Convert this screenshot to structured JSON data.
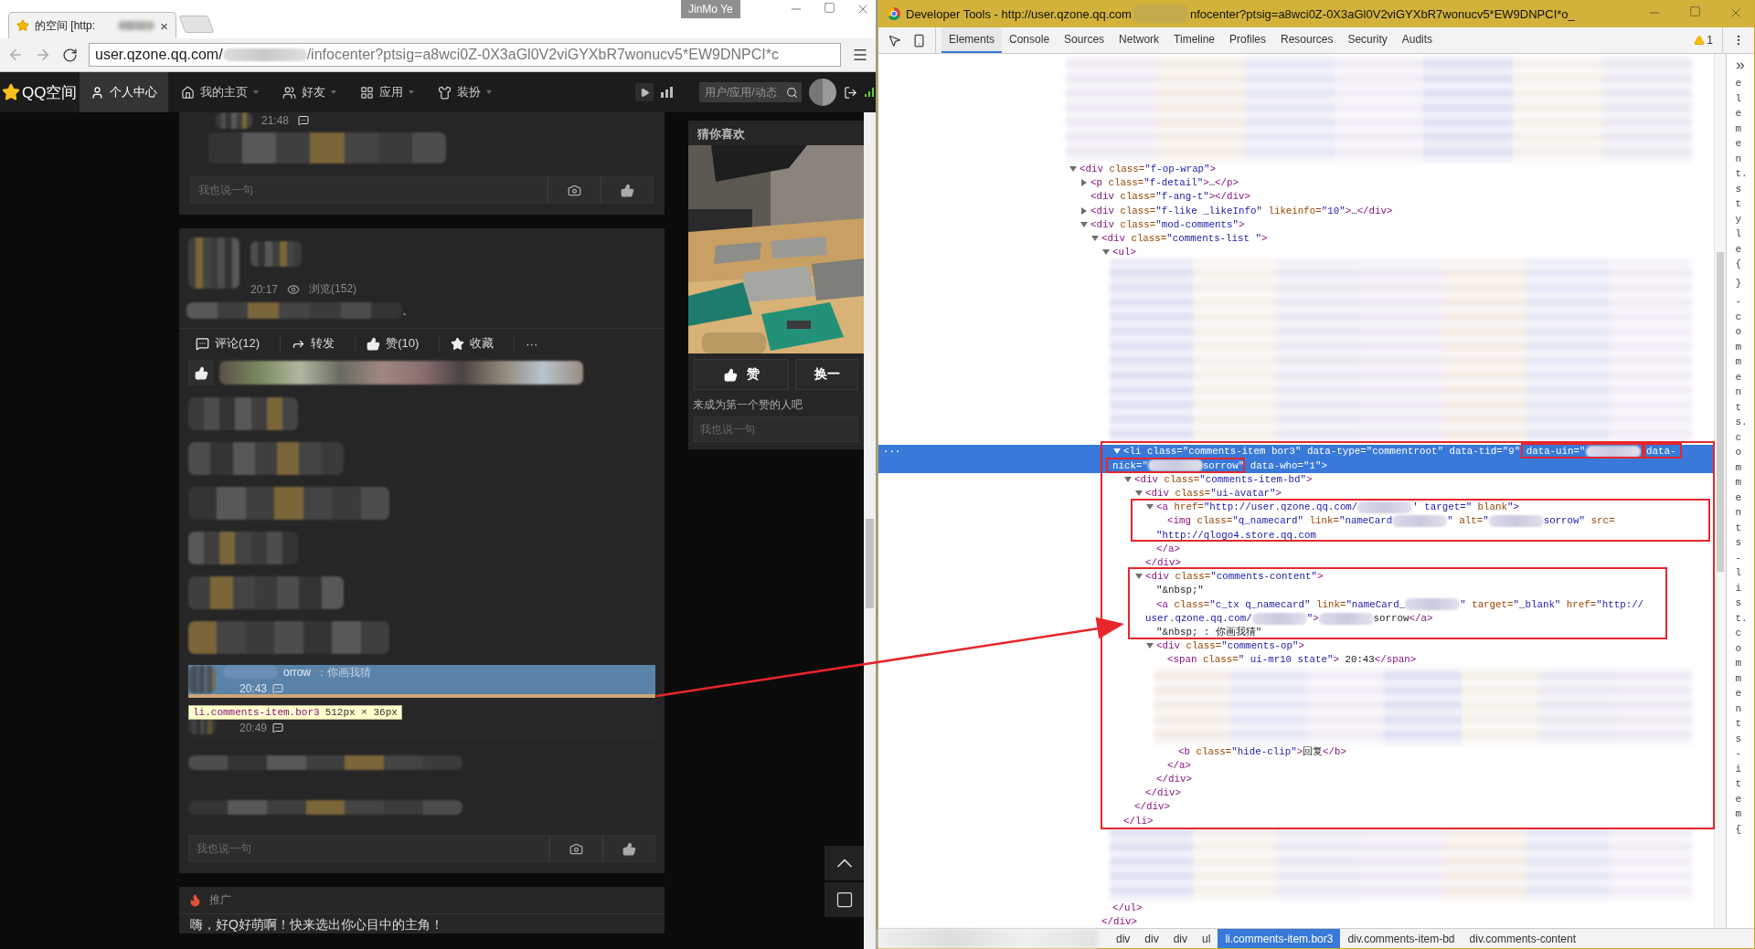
{
  "browser": {
    "tab": {
      "title": "的空间 [http:",
      "close": "×"
    },
    "profile": "JinMo Ye",
    "address": [
      "user.qzone.qq.com/",
      "/infocenter?ptsig=a8wci0Z-0X3aGl0V2viGYXbR7wonucv5*EW9DNPCI*c"
    ],
    "site_nav": {
      "logo": "QQ空间",
      "items": [
        {
          "label": "个人中心",
          "selected": true,
          "dropdown": false
        },
        {
          "label": "我的主页",
          "selected": false,
          "dropdown": true
        },
        {
          "label": "好友",
          "selected": false,
          "dropdown": true
        },
        {
          "label": "应用",
          "selected": false,
          "dropdown": true
        },
        {
          "label": "装扮",
          "selected": false,
          "dropdown": true
        }
      ],
      "search": {
        "placeholder": "用户/应用/动态"
      }
    },
    "feed": {
      "top_post": {
        "time": "21:48",
        "comment_box": {
          "placeholder": "我也说一句"
        }
      },
      "post": {
        "time": "20:17",
        "views": "浏览(152)",
        "text_tail": "。",
        "actions": [
          {
            "label": "评论(12)"
          },
          {
            "label": "转发"
          },
          {
            "label": "赞(10)"
          },
          {
            "label": "收藏"
          },
          {
            "label": "···"
          }
        ],
        "comments": [
          {
            "kind": "redacted"
          },
          {
            "kind": "redacted"
          },
          {
            "kind": "redacted"
          },
          {
            "kind": "redacted"
          },
          {
            "kind": "redacted"
          },
          {
            "kind": "redacted"
          },
          {
            "kind": "comment",
            "name": "orrow",
            "text": "：你画我猜",
            "time": "20:43",
            "inspected": true
          },
          {
            "kind": "comment",
            "time": "20:49",
            "inspected": false
          },
          {
            "kind": "redacted"
          },
          {
            "kind": "redacted"
          }
        ],
        "comment_box": {
          "placeholder": "我也说一句"
        }
      },
      "promo": {
        "label": "推广",
        "text": "嗨，好Q好萌啊！快来选出你心目中的主角！"
      }
    },
    "inspect_tooltip": {
      "selector": "li.comments-item.bor3",
      "size": "512px × 36px"
    },
    "sidebar": {
      "title": "猜你喜欢",
      "like": "赞",
      "next": "换一",
      "hint": "来成为第一个赞的人吧",
      "comment_box": {
        "placeholder": "我也说一句"
      }
    }
  },
  "devtools": {
    "title": [
      "Developer Tools - http://user.qzone.qq.com",
      "nfocenter?ptsig=a8wci0Z-0X3aGl0V2viGYXbR7wonucv5*EW9DNPCI*o_"
    ],
    "tabs": [
      {
        "label": "Elements",
        "selected": true
      },
      {
        "label": "Console",
        "selected": false
      },
      {
        "label": "Sources",
        "selected": false
      },
      {
        "label": "Network",
        "selected": false
      },
      {
        "label": "Timeline",
        "selected": false
      },
      {
        "label": "Profiles",
        "selected": false
      },
      {
        "label": "Resources",
        "selected": false
      },
      {
        "label": "Security",
        "selected": false
      },
      {
        "label": "Audits",
        "selected": false
      }
    ],
    "warning_count": "1",
    "dom": [
      {
        "kind": "redacted"
      },
      {
        "kind": "node",
        "lines": [
          [
            "<div class=\"f-op-wrap\">"
          ]
        ],
        "expanded": true,
        "selected": false,
        "children": [
          {
            "kind": "node",
            "lines": [
              [
                "<p class=\"f-detail\">…</p>"
              ]
            ],
            "expanded": false,
            "selected": false
          },
          {
            "kind": "node",
            "lines": [
              [
                "<div class=\"f-ang-t\"></div>"
              ]
            ],
            "selected": false
          },
          {
            "kind": "node",
            "lines": [
              [
                "<div class=\"f-like _likeInfo\" likeinfo=\"10\">…</div>"
              ]
            ],
            "expanded": false,
            "selected": false
          },
          {
            "kind": "node",
            "lines": [
              [
                "<div class=\"mod-comments\">"
              ]
            ],
            "expanded": true,
            "selected": false,
            "children": [
              {
                "kind": "node",
                "lines": [
                  [
                    "<div class=\"comments-list \">"
                  ]
                ],
                "expanded": true,
                "selected": false,
                "children": [
                  {
                    "kind": "node",
                    "lines": [
                      [
                        "<ul>"
                      ]
                    ],
                    "expanded": true,
                    "selected": false,
                    "children": [
                      {
                        "kind": "redacted"
                      },
                      {
                        "kind": "node",
                        "lines": [
                          [
                            "<li class=\"comments-item bor3\" data-type=\"commentroot\" data-tid=\"9\" data-uin=\"",
                            " data-"
                          ],
                          [
                            "nick=\"",
                            "sorrow\" data-who=\"1\">"
                          ]
                        ],
                        "expanded": true,
                        "selected": true,
                        "menu": "···",
                        "children": [
                          {
                            "kind": "node",
                            "lines": [
                              [
                                "<div class=\"comments-item-bd\">"
                              ]
                            ],
                            "expanded": true,
                            "selected": false,
                            "children": [
                              {
                                "kind": "node",
                                "lines": [
                                  [
                                    "<div class=\"ui-avatar\">"
                                  ]
                                ],
                                "expanded": true,
                                "selected": false,
                                "children": [
                                  {
                                    "kind": "node",
                                    "lines": [
                                      [
                                        "<a href=\"http://user.qzone.qq.com/",
                                        "' target=\" blank\">"
                                      ]
                                    ],
                                    "expanded": true,
                                    "selected": false,
                                    "children": [
                                      {
                                        "kind": "node",
                                        "lines": [
                                          [
                                            "<img class=\"q_namecard\" link=\"nameCard",
                                            "\" alt=\"",
                                            "sorrow\" src="
                                          ],
                                          [
                                            "\"http://qlogo4.store.qq.com"
                                          ]
                                        ],
                                        "selected": false
                                      }
                                    ],
                                    "close": "</a>"
                                  }
                                ],
                                "close": "</div>"
                              },
                              {
                                "kind": "node",
                                "lines": [
                                  [
                                    "<div class=\"comments-content\">"
                                  ]
                                ],
                                "expanded": true,
                                "selected": false,
                                "children": [
                                  {
                                    "kind": "node",
                                    "lines": [
                                      [
                                        "\"&nbsp;\""
                                      ]
                                    ],
                                    "selected": false
                                  },
                                  {
                                    "kind": "node",
                                    "lines": [
                                      [
                                        "<a class=\"c_tx q_namecard\" link=\"nameCard_",
                                        "\" target=\"_blank\" href=\"http://"
                                      ],
                                      [
                                        "user.qzone.qq.com/",
                                        "\">",
                                        "sorrow</a>"
                                      ]
                                    ],
                                    "selected": false
                                  },
                                  {
                                    "kind": "node",
                                    "lines": [
                                      [
                                        "\"&nbsp; : 你画我猜\""
                                      ]
                                    ],
                                    "selected": false
                                  },
                                  {
                                    "kind": "node",
                                    "lines": [
                                      [
                                        "<div class=\"comments-op\">"
                                      ]
                                    ],
                                    "expanded": true,
                                    "selected": false,
                                    "children": [
                                      {
                                        "kind": "node",
                                        "lines": [
                                          [
                                            "<span class=\" ui-mr10 state\"> 20:43</span>"
                                          ]
                                        ],
                                        "selected": false
                                      },
                                      {
                                        "kind": "redacted",
                                        "children": [
                                          {
                                            "kind": "node",
                                            "lines": [
                                              [
                                                "<b class=\"hide-clip\">回复</b>"
                                              ]
                                            ],
                                            "selected": false
                                          }
                                        ],
                                        "close": "</a>"
                                      }
                                    ],
                                    "close": "</div>"
                                  }
                                ],
                                "close": "</div>"
                              }
                            ],
                            "close": "</div>"
                          }
                        ],
                        "close": "</li>"
                      },
                      {
                        "kind": "redacted"
                      }
                    ],
                    "close": "</ul>"
                  }
                ],
                "close": "</div>"
              }
            ]
          }
        ]
      }
    ],
    "breadcrumbs": [
      {
        "label": "div",
        "selected": false
      },
      {
        "label": "div",
        "selected": false
      },
      {
        "label": "div",
        "selected": false
      },
      {
        "label": "ul",
        "selected": false
      },
      {
        "label": "li.comments-item.bor3",
        "selected": true
      },
      {
        "label": "div.comments-item-bd",
        "selected": false
      },
      {
        "label": "div.comments-content",
        "selected": false
      }
    ],
    "side_pane": [
      "element.style{",
      "}",
      "-comments.comments-list.comments-item{"
    ]
  },
  "annotations": [
    {
      "kind": "box"
    },
    {
      "kind": "box"
    },
    {
      "kind": "box"
    },
    {
      "kind": "box"
    },
    {
      "kind": "box"
    },
    {
      "kind": "box"
    },
    {
      "kind": "arrow"
    }
  ]
}
